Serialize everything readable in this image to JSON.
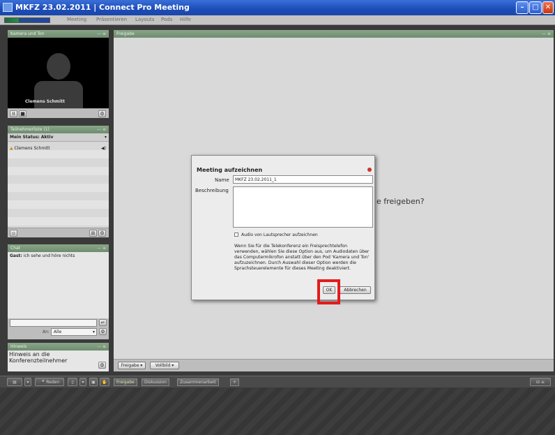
{
  "window": {
    "title": "MKFZ 23.02.2011 | Connect Pro Meeting"
  },
  "menu": [
    "Meeting",
    "Präsentieren",
    "Layouts",
    "Pods",
    "Hilfe"
  ],
  "camera_pod": {
    "title": "Kamera und Ton",
    "presenter": "Clemens Schmitt"
  },
  "attendee_pod": {
    "title": "Teilnehmerliste (1)",
    "status": "Mein Status: Aktiv",
    "attendees": [
      "Clemens Schmitt"
    ]
  },
  "chat_pod": {
    "title": "Chat",
    "message_sender": "Gast:",
    "message_text": " ich sehe und höre nichts",
    "to_label": "An:",
    "to_value": "Alle"
  },
  "note_pod": {
    "title": "Hinweis",
    "text": "Hinweis an die Konferenzteilnehmer"
  },
  "share_pod": {
    "title": "Freigabe",
    "prompt_fragment": "e freigeben?",
    "share_button": "Freigabe",
    "fullscreen_button": "Vollbild"
  },
  "dialog": {
    "title": "Meeting aufzeichnen",
    "name_label": "Name",
    "name_value": "MKFZ 23.02.2011_1",
    "description_label": "Beschreibung",
    "checkbox_label": "Audio von Lautsprecher aufzeichnen",
    "info_text": "Wenn Sie für die Telekonferenz ein Freisprechtelefon verwenden, wählen Sie diese Option aus, um Audiodaten über das Computermikrofon anstatt über den Pod 'Kamera und Ton' aufzuzeichnen. Durch Auswahl dieser Option werden die Sprachsteuerelemente für dieses Meeting deaktiviert.",
    "ok_label": "OK",
    "cancel_label": "Abbrechen"
  },
  "bottombar": {
    "speak_label": "Reden",
    "tabs": [
      "Freigabe",
      "Diskussion",
      "Zusammenarbeit"
    ],
    "add_label": "+"
  },
  "colors": {
    "titlebar": "#1c4cb8",
    "pod_header": "#7e9b7e",
    "highlight": "#e31b1b"
  }
}
